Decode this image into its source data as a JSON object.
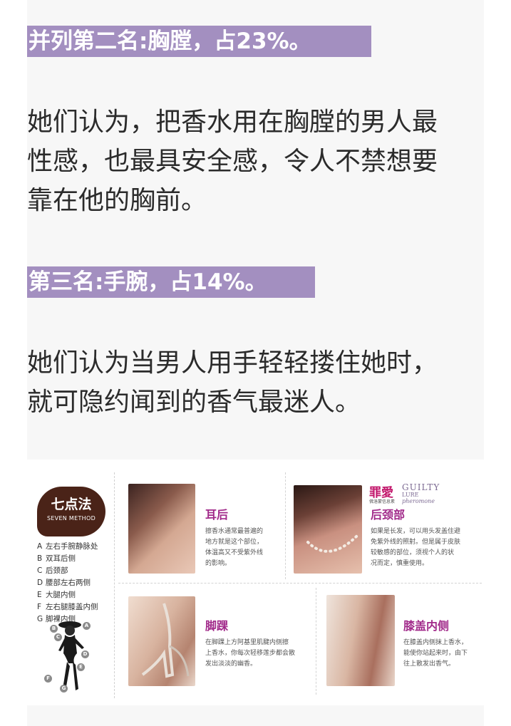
{
  "sections": [
    {
      "heading": "并列第二名:胸膛，占23%。",
      "lines": [
        "她们认为，把香水用在胸膛的男人最",
        "性感，也最具安全感，令人不禁想要",
        "靠在他的胸前。"
      ]
    },
    {
      "heading": "第三名:手腕，占14%。",
      "lines": [
        "她们认为当男人用手轻轻搂住她时，",
        "就可隐约闻到的香气最迷人。"
      ]
    }
  ],
  "infographic": {
    "badge_title": "七点法",
    "badge_subtitle": "SEVEN METHOD",
    "methods": [
      {
        "letter": "A",
        "text": "左右手腕静脉处"
      },
      {
        "letter": "B",
        "text": "双耳后侧"
      },
      {
        "letter": "C",
        "text": "后颈部"
      },
      {
        "letter": "D",
        "text": "腰部左右两侧"
      },
      {
        "letter": "E",
        "text": "大腿内侧"
      },
      {
        "letter": "F",
        "text": "左右腿膝盖内侧"
      },
      {
        "letter": "G",
        "text": "脚裸内侧"
      }
    ],
    "brand": {
      "mark": "罪愛",
      "mark_sub": "佛洛蒙信息素",
      "english": "GUILTY",
      "lure": "LURE",
      "pheromone": "pheromone"
    },
    "panels": [
      {
        "title": "耳后",
        "lines": [
          "擦香水通常最普遍的",
          "地方就是这个部位，",
          "体温高又不受紫外线",
          "的影响。"
        ]
      },
      {
        "title": "后颈部",
        "lines": [
          "如果是长发，可以用头发盖住避",
          "免紫外线的照射。但是属于皮肤",
          "较敏感的部位，须视个人的状",
          "况而定，慎重使用。"
        ]
      },
      {
        "title": "脚踝",
        "lines": [
          "在脚踝上方阿基里肌腱内侧擦",
          "上香水，你每次轻移莲步都会散",
          "发出淡淡的幽香。"
        ]
      },
      {
        "title": "膝盖内侧",
        "lines": [
          "在膝盖内侧抹上香水，",
          "能使你站起来时，由下",
          "往上散发出香气。"
        ]
      }
    ],
    "figure_dots": [
      "A",
      "B",
      "C",
      "D",
      "E",
      "F",
      "G"
    ],
    "colors": {
      "heading_bg": "#a38fc0",
      "panel_title": "#a12a8a",
      "badge_bg": "#4a2318",
      "brand": "#c2186c"
    }
  }
}
